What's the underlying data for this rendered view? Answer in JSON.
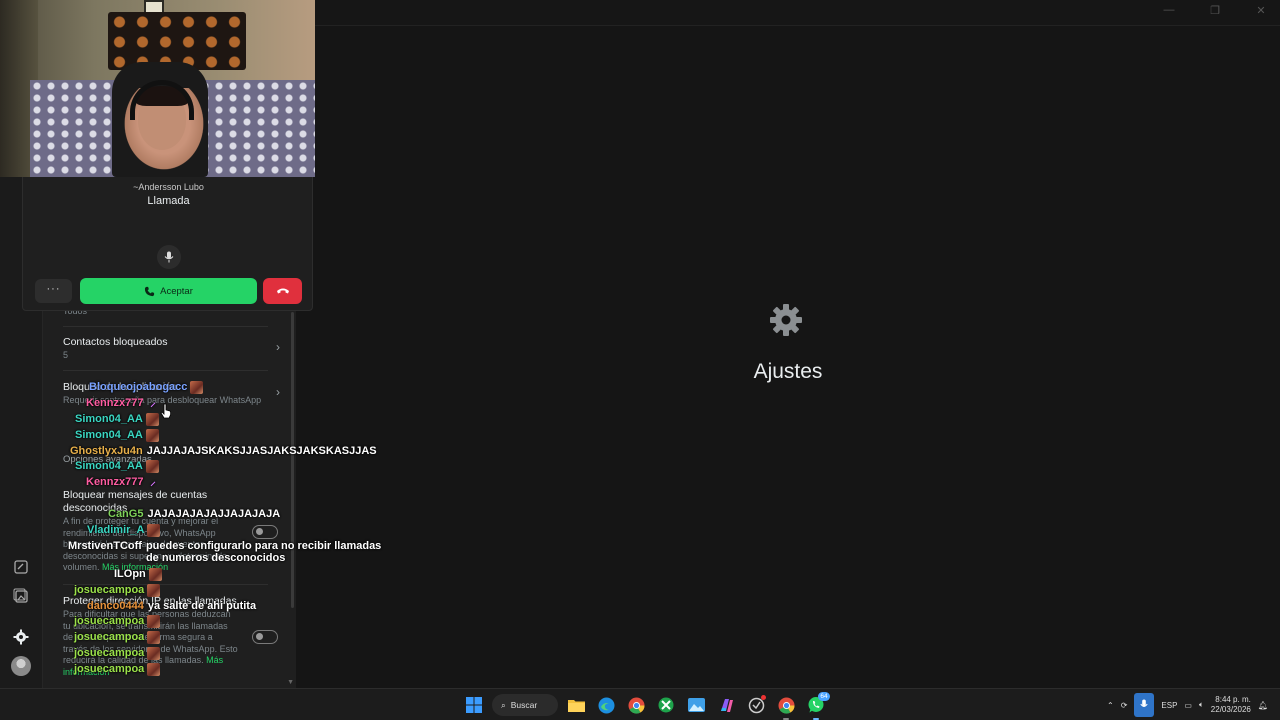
{
  "main": {
    "title": "Ajustes",
    "icon": "gear-icon"
  },
  "call": {
    "caller": "~Andersson Lubo",
    "status": "Llamada",
    "more_label": "···",
    "accept_label": "Aceptar"
  },
  "settings": {
    "partial_top": "Todos",
    "blocked_contacts": {
      "title": "Contactos bloqueados",
      "count": "5"
    },
    "app_lock": {
      "title": "Bloqueo de la aplicación",
      "subtitle": "Requerir contraseña para desbloquear WhatsApp"
    },
    "advanced_header": "Opciones avanzadas",
    "block_unknown": {
      "title": "Bloquear mensajes de cuentas desconocidas",
      "subtitle": "A fin de proteger tu cuenta y mejorar el rendimiento del dispositivo, WhatsApp bloqueará los mensajes de cuentas desconocidas si superan un determinado volumen.",
      "link": "Más información"
    },
    "protect_ip": {
      "title": "Proteger dirección IP en las llamadas",
      "subtitle": "Para dificultar que las personas deduzcan tu ubicación, se transmitirán las llamadas de este dispositivo de forma segura a través de los servidores de WhatsApp. Esto reducirá la calidad de las llamadas.",
      "link": "Más información"
    }
  },
  "chat": [
    {
      "user": "Bloqueojoabogacc",
      "text": "",
      "color": "#7aa2ff",
      "badge": "avatar"
    },
    {
      "user": "Kennzx777",
      "text": "",
      "color": "#ff5da2",
      "badge": "feather"
    },
    {
      "user": "Simon04_AA",
      "text": "",
      "color": "#3ad6c2",
      "badge": "avatar"
    },
    {
      "user": "Simon04_AA",
      "text": "",
      "color": "#3ad6c2",
      "badge": "avatar"
    },
    {
      "user": "GhostlyxJu4n",
      "text": "JAJJAJAJSKAKSJJASJAKSJAKSKASJJAS",
      "color": "#e8b04a",
      "badge": ""
    },
    {
      "user": "Simon04_AA",
      "text": "",
      "color": "#3ad6c2",
      "badge": "avatar"
    },
    {
      "user": "Kennzx777",
      "text": "",
      "color": "#ff5da2",
      "badge": "feather"
    },
    {
      "user": "CanG5",
      "text": "JAJAJAJAJAJJAJAJAJA",
      "color": "#7fd25a",
      "badge": ""
    },
    {
      "user": "Vladimir_A",
      "text": "",
      "color": "#3ad6c2",
      "badge": "avatar"
    },
    {
      "user": "MrstivenTCoff",
      "text": "puedes configurarlo para no recibir llamadas de numeros desconocidos",
      "color": "#ffffff",
      "badge": ""
    },
    {
      "user": "ILOpn",
      "text": "",
      "color": "#ffffff",
      "badge": "avatar"
    },
    {
      "user": "josuecampoa",
      "text": "",
      "color": "#9be14a",
      "badge": "avatar"
    },
    {
      "user": "danco0444",
      "text": "ya salte de ahi putita",
      "color": "#e8923a",
      "badge": ""
    },
    {
      "user": "josuecampoa",
      "text": "",
      "color": "#9be14a",
      "badge": "avatar"
    },
    {
      "user": "josuecampoa",
      "text": "",
      "color": "#9be14a",
      "badge": "avatar"
    },
    {
      "user": "josuecampoa",
      "text": "",
      "color": "#9be14a",
      "badge": "avatar"
    },
    {
      "user": "josuecampoa",
      "text": "",
      "color": "#9be14a",
      "badge": "avatar"
    }
  ],
  "taskbar": {
    "search_label": "Buscar",
    "whatsapp_badge": "64",
    "language": "ESP",
    "time": "8:44 p. m.",
    "date": "22/03/2026"
  }
}
